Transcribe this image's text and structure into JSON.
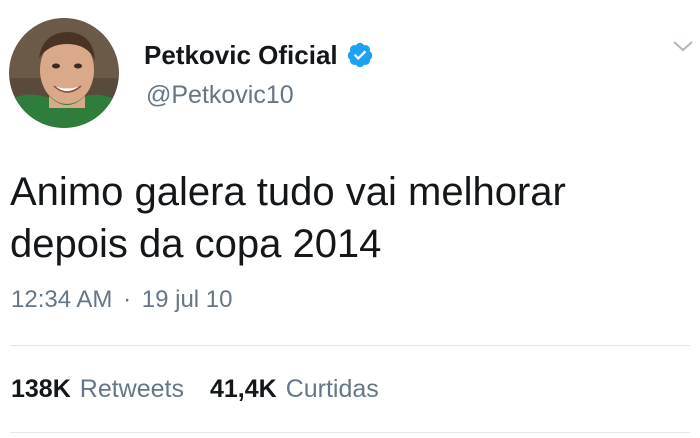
{
  "user": {
    "display_name": "Petkovic Oficial",
    "handle": "@Petkovic10",
    "verified": true,
    "avatar_icon": "profile-photo"
  },
  "tweet": {
    "lines": [
      "Animo galera tudo vai melhorar",
      "depois da copa 2014"
    ],
    "time": "12:34 AM",
    "separator": "·",
    "date": "19 jul 10"
  },
  "stats": {
    "retweets_count": "138K",
    "retweets_label": "Retweets",
    "likes_count": "41,4K",
    "likes_label": "Curtidas"
  },
  "colors": {
    "verified_blue": "#1da1f2",
    "secondary_text": "#657786",
    "primary_text": "#14171a"
  }
}
